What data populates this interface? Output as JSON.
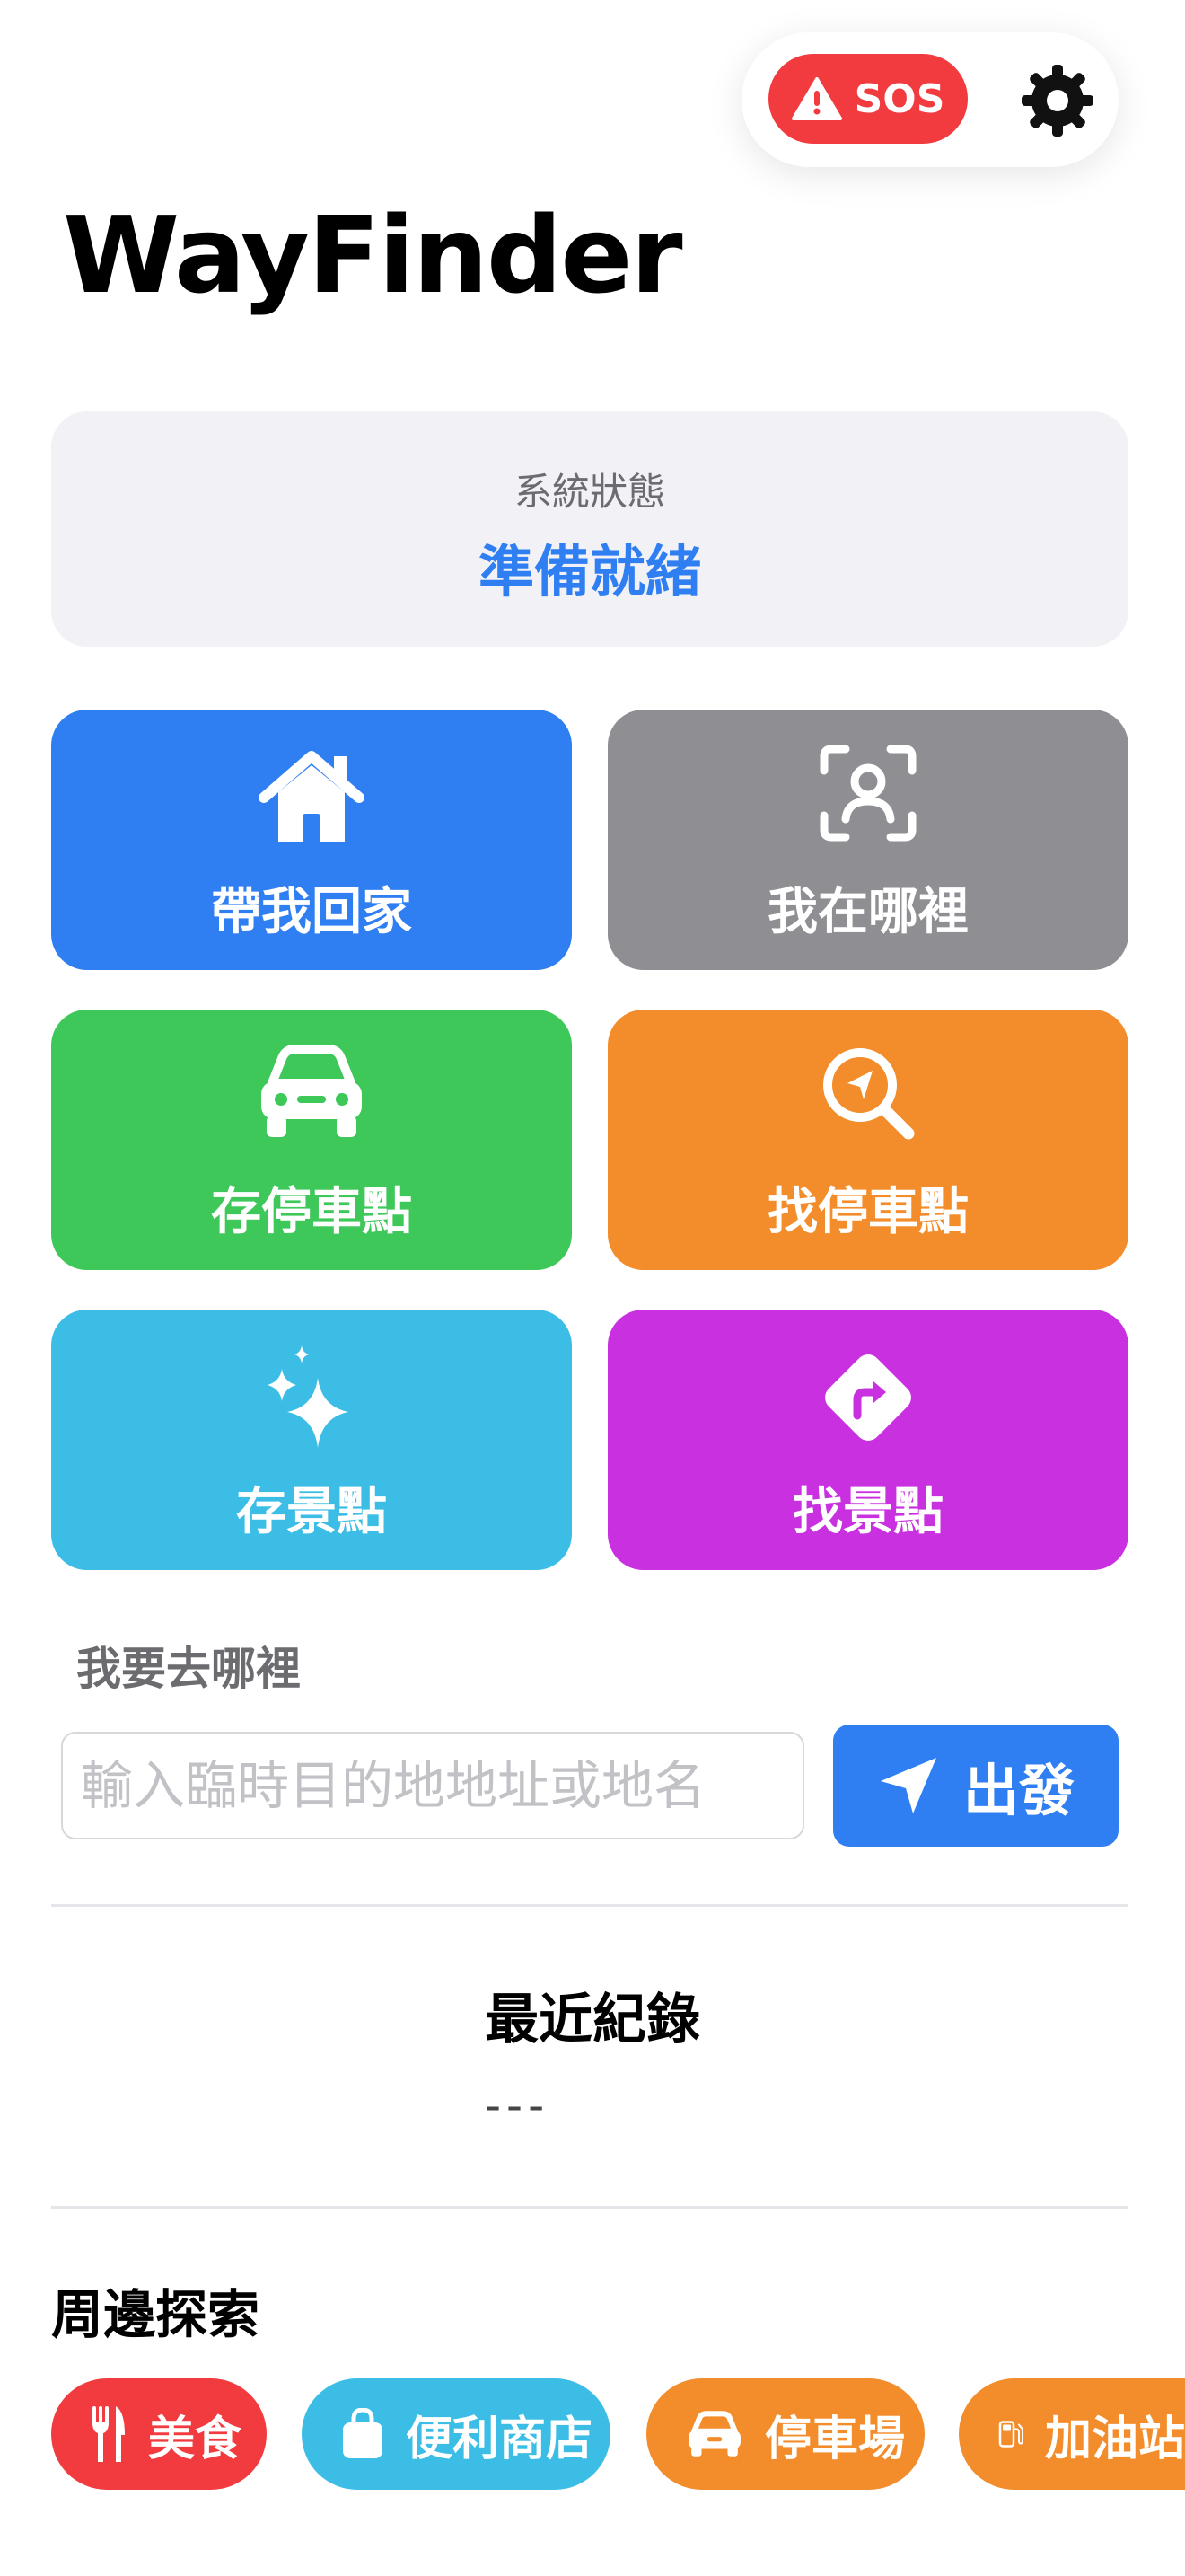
{
  "header": {
    "sos_label": "SOS",
    "app_title": "WayFinder"
  },
  "status": {
    "label": "系統狀態",
    "value": "準備就緒"
  },
  "tiles": [
    {
      "label": "帶我回家",
      "icon": "house-icon",
      "color": "#2f7ff2"
    },
    {
      "label": "我在哪裡",
      "icon": "person-viewfinder-icon",
      "color": "#8e8e93"
    },
    {
      "label": "存停車點",
      "icon": "car-icon",
      "color": "#3ec85a"
    },
    {
      "label": "找停車點",
      "icon": "location-search-icon",
      "color": "#f38c2b"
    },
    {
      "label": "存景點",
      "icon": "sparkles-icon",
      "color": "#3cbde6"
    },
    {
      "label": "找景點",
      "icon": "turn-right-sign-icon",
      "color": "#c930e0"
    }
  ],
  "destination": {
    "section_label": "我要去哪裡",
    "placeholder": "輸入臨時目的地地址或地名",
    "go_label": "出發"
  },
  "recent": {
    "title": "最近紀錄",
    "empty_text": "---"
  },
  "explore": {
    "title": "周邊探索",
    "chips": [
      {
        "label": "美食",
        "icon": "fork-knife-icon",
        "color": "#f23b3f"
      },
      {
        "label": "便利商店",
        "icon": "shopping-bag-icon",
        "color": "#3cbde6"
      },
      {
        "label": "停車場",
        "icon": "car-icon",
        "color": "#f38c2b"
      },
      {
        "label": "加油站",
        "icon": "fuel-pump-icon",
        "color": "#f38c2b"
      }
    ]
  }
}
